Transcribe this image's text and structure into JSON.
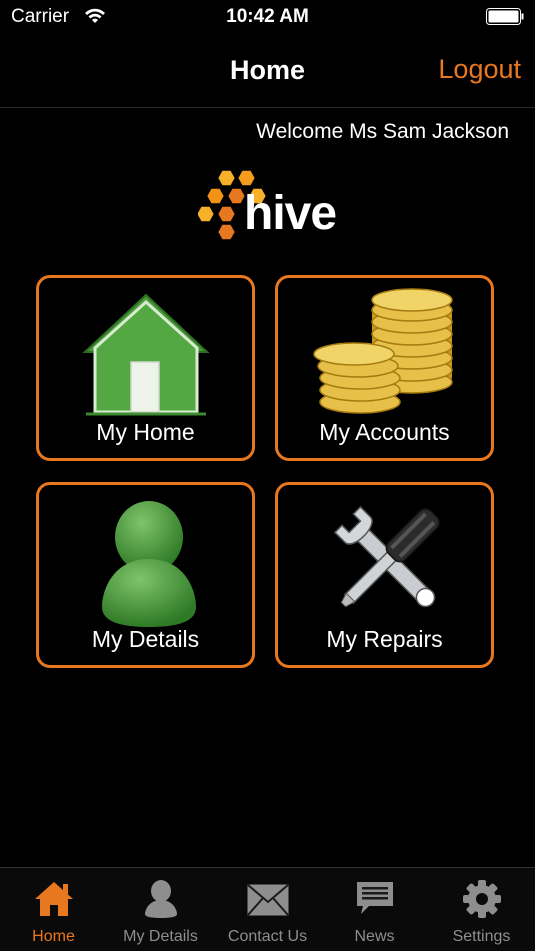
{
  "status_bar": {
    "carrier": "Carrier",
    "time": "10:42 AM"
  },
  "nav": {
    "title": "Home",
    "logout_label": "Logout"
  },
  "welcome": "Welcome Ms Sam Jackson",
  "logo_text": "hive",
  "tiles": [
    {
      "label": "My Home",
      "icon": "house-icon"
    },
    {
      "label": "My Accounts",
      "icon": "coins-icon"
    },
    {
      "label": "My Details",
      "icon": "person-icon"
    },
    {
      "label": "My Repairs",
      "icon": "tools-icon"
    }
  ],
  "tabs": [
    {
      "label": "Home",
      "icon": "home-icon",
      "active": true
    },
    {
      "label": "My Details",
      "icon": "person-icon"
    },
    {
      "label": "Contact Us",
      "icon": "envelope-icon"
    },
    {
      "label": "News",
      "icon": "news-icon"
    },
    {
      "label": "Settings",
      "icon": "gear-icon"
    }
  ],
  "colors": {
    "accent": "#e8781f",
    "background": "#000000",
    "inactive_tab": "#8e8e8e"
  }
}
